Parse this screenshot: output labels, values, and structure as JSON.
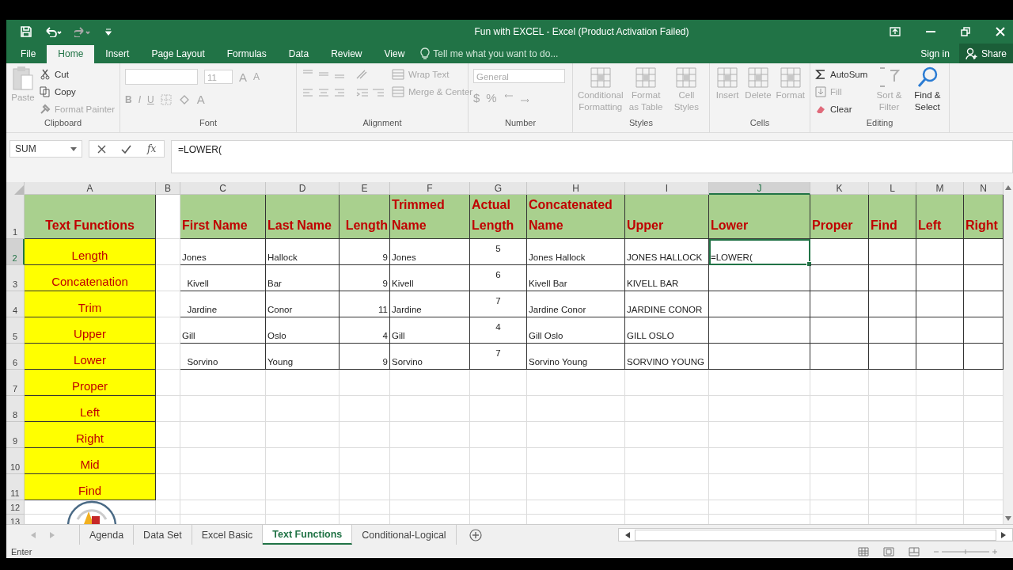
{
  "window": {
    "title": "Fun with EXCEL - Excel (Product Activation Failed)"
  },
  "quick_access": [
    {
      "kind": "save",
      "disabled": false
    },
    {
      "kind": "undo",
      "disabled": false
    },
    {
      "kind": "redo",
      "disabled": true
    },
    {
      "kind": "customize",
      "disabled": false
    }
  ],
  "ribbon_tabs": [
    {
      "label": "File",
      "selected": false
    },
    {
      "label": "Home",
      "selected": true
    },
    {
      "label": "Insert",
      "selected": false
    },
    {
      "label": "Page Layout",
      "selected": false
    },
    {
      "label": "Formulas",
      "selected": false
    },
    {
      "label": "Data",
      "selected": false
    },
    {
      "label": "Review",
      "selected": false
    },
    {
      "label": "View",
      "selected": false
    }
  ],
  "tell_me": {
    "placeholder": "Tell me what you want to do..."
  },
  "account": {
    "sign_in": "Sign in",
    "share": "Share"
  },
  "ribbon_groups": [
    {
      "kind": "clipboard",
      "label": "Clipboard",
      "items": [
        {
          "label": "Paste",
          "disabled": true
        },
        {
          "label": "Cut",
          "disabled": false
        },
        {
          "label": "Copy",
          "disabled": false
        },
        {
          "label": "Format Painter",
          "disabled": true
        }
      ]
    },
    {
      "kind": "font",
      "label": "Font",
      "size": "11",
      "items": [
        {
          "label": "A",
          "disabled": true
        },
        {
          "label": "A",
          "disabled": true
        },
        {
          "label": "B",
          "disabled": true
        },
        {
          "label": "I",
          "disabled": true
        },
        {
          "label": "U",
          "disabled": true
        },
        {
          "label": "A",
          "disabled": true
        }
      ]
    },
    {
      "kind": "alignment",
      "label": "Alignment",
      "items": [
        {
          "label": "Wrap Text",
          "disabled": true
        },
        {
          "label": "Merge & Center",
          "disabled": true
        }
      ]
    },
    {
      "kind": "number",
      "label": "Number",
      "format": "General",
      "items": [
        {
          "label": "$",
          "disabled": true
        },
        {
          "label": "%",
          "disabled": true
        }
      ]
    },
    {
      "kind": "styles",
      "label": "Styles",
      "items": [
        {
          "label": "Conditional Formatting",
          "disabled": true
        },
        {
          "label": "Format as Table",
          "disabled": true
        },
        {
          "label": "Cell Styles",
          "disabled": true
        }
      ]
    },
    {
      "kind": "cells",
      "label": "Cells",
      "items": [
        {
          "label": "Insert",
          "disabled": true
        },
        {
          "label": "Delete",
          "disabled": true
        },
        {
          "label": "Format",
          "disabled": true
        }
      ]
    },
    {
      "kind": "editing",
      "label": "Editing",
      "items": [
        {
          "label": "AutoSum",
          "disabled": false
        },
        {
          "label": "Fill",
          "disabled": true
        },
        {
          "label": "Clear",
          "disabled": false
        },
        {
          "label": "Sort & Filter",
          "disabled": true
        },
        {
          "label": "Find & Select",
          "disabled": false
        }
      ]
    }
  ],
  "formula_bar": {
    "name_box": "SUM",
    "function_label": "fx",
    "formula": "=LOWER("
  },
  "columns": [
    "A",
    "B",
    "C",
    "D",
    "E",
    "F",
    "G",
    "H",
    "I",
    "J",
    "K",
    "L",
    "M",
    "N"
  ],
  "rows": [
    {
      "number": "1",
      "kind": "header",
      "cells": {
        "A": {
          "text": "Text Functions",
          "selected": false
        },
        "C": {
          "text": "First Name",
          "selected": false
        },
        "D": {
          "text": "Last Name",
          "selected": false
        },
        "E": {
          "text": "Length",
          "selected": false
        },
        "F": {
          "text": "Trimmed Name",
          "selected": false
        },
        "G": {
          "text": "Actual Length",
          "selected": false
        },
        "H": {
          "text": "Concatenated Name",
          "selected": false
        },
        "I": {
          "text": "Upper",
          "selected": false
        },
        "J": {
          "text": "Lower",
          "selected": false
        },
        "K": {
          "text": "Proper",
          "selected": false
        },
        "L": {
          "text": "Find",
          "selected": false
        },
        "M": {
          "text": "Left",
          "selected": false
        },
        "N": {
          "text": "Right",
          "selected": false
        }
      }
    },
    {
      "number": "2",
      "kind": "data",
      "cells": {
        "A": {
          "text": "Length",
          "selected": false
        },
        "C": {
          "text": "Jones",
          "selected": false
        },
        "D": {
          "text": "Hallock",
          "selected": false
        },
        "E": {
          "text": "9",
          "selected": false
        },
        "F": {
          "text": "Jones",
          "selected": false
        },
        "G": {
          "text": "5",
          "selected": false
        },
        "H": {
          "text": "Jones Hallock",
          "selected": false
        },
        "I": {
          "text": "JONES HALLOCK",
          "selected": false
        },
        "J": {
          "text": "=LOWER(",
          "selected": true
        }
      }
    },
    {
      "number": "3",
      "kind": "data",
      "cells": {
        "A": {
          "text": "Concatenation",
          "selected": false
        },
        "C": {
          "text": "  Kivell",
          "selected": false
        },
        "D": {
          "text": "Bar",
          "selected": false
        },
        "E": {
          "text": "9",
          "selected": false
        },
        "F": {
          "text": "Kivell",
          "selected": false
        },
        "G": {
          "text": "6",
          "selected": false
        },
        "H": {
          "text": "Kivell Bar",
          "selected": false
        },
        "I": {
          "text": "KIVELL BAR",
          "selected": false
        }
      }
    },
    {
      "number": "4",
      "kind": "data",
      "cells": {
        "A": {
          "text": "Trim",
          "selected": false
        },
        "C": {
          "text": "  Jardine",
          "selected": false
        },
        "D": {
          "text": "Conor",
          "selected": false
        },
        "E": {
          "text": "11",
          "selected": false
        },
        "F": {
          "text": "Jardine",
          "selected": false
        },
        "G": {
          "text": "7",
          "selected": false
        },
        "H": {
          "text": "Jardine Conor",
          "selected": false
        },
        "I": {
          "text": "JARDINE CONOR",
          "selected": false
        }
      }
    },
    {
      "number": "5",
      "kind": "data",
      "cells": {
        "A": {
          "text": "Upper",
          "selected": false
        },
        "C": {
          "text": "Gill",
          "selected": false
        },
        "D": {
          "text": "Oslo",
          "selected": false
        },
        "E": {
          "text": "4",
          "selected": false
        },
        "F": {
          "text": "Gill",
          "selected": false
        },
        "G": {
          "text": "4",
          "selected": false
        },
        "H": {
          "text": "Gill Oslo",
          "selected": false
        },
        "I": {
          "text": "GILL OSLO",
          "selected": false
        }
      }
    },
    {
      "number": "6",
      "kind": "data",
      "cells": {
        "A": {
          "text": "Lower",
          "selected": false
        },
        "C": {
          "text": "  Sorvino",
          "selected": false
        },
        "D": {
          "text": "Young",
          "selected": false
        },
        "E": {
          "text": "9",
          "selected": false
        },
        "F": {
          "text": "Sorvino",
          "selected": false
        },
        "G": {
          "text": "7",
          "selected": false
        },
        "H": {
          "text": "Sorvino Young",
          "selected": false
        },
        "I": {
          "text": "SORVINO YOUNG",
          "selected": false
        }
      }
    },
    {
      "number": "7",
      "kind": "list",
      "cells": {
        "A": {
          "text": "Proper",
          "selected": false
        }
      }
    },
    {
      "number": "8",
      "kind": "list",
      "cells": {
        "A": {
          "text": "Left",
          "selected": false
        }
      }
    },
    {
      "number": "9",
      "kind": "list",
      "cells": {
        "A": {
          "text": "Right",
          "selected": false
        }
      }
    },
    {
      "number": "10",
      "kind": "list",
      "cells": {
        "A": {
          "text": "Mid",
          "selected": false
        }
      }
    },
    {
      "number": "11",
      "kind": "list",
      "cells": {
        "A": {
          "text": "Find",
          "selected": false
        }
      }
    },
    {
      "number": "12",
      "kind": "blank"
    },
    {
      "number": "13",
      "kind": "blank"
    }
  ],
  "sheet_tabs": [
    {
      "label": "Agenda",
      "selected": false
    },
    {
      "label": "Data Set",
      "selected": false
    },
    {
      "label": "Excel Basic",
      "selected": false
    },
    {
      "label": "Text Functions",
      "selected": true
    },
    {
      "label": "Conditional-Logical",
      "selected": false
    }
  ],
  "status_bar": {
    "mode": "Enter"
  }
}
